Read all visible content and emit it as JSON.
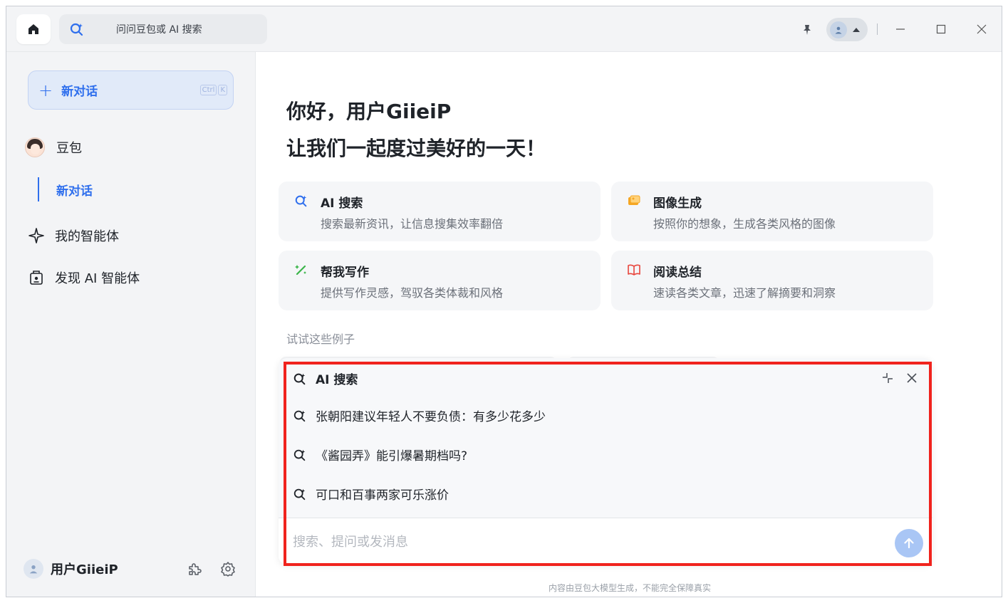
{
  "colors": {
    "accent": "#2f6fed",
    "highlight": "#f0231d",
    "sidebar_bg": "#f3f4f6"
  },
  "titlebar": {
    "search_placeholder": "问问豆包或 AI 搜索",
    "icons": [
      "home-icon",
      "ai-search-icon",
      "pin-icon",
      "user-avatar-icon",
      "caret-up-icon",
      "minimize-icon",
      "maximize-icon",
      "close-icon"
    ]
  },
  "sidebar": {
    "new_chat": {
      "label": "新对话",
      "shortcut": [
        "Ctrl",
        "K"
      ]
    },
    "bot": {
      "name": "豆包",
      "sub_item": "新对话"
    },
    "nav": [
      {
        "label": "我的智能体",
        "icon": "sparkle-icon"
      },
      {
        "label": "发现 AI 智能体",
        "icon": "discover-agent-icon"
      }
    ],
    "user": {
      "name": "用户GiieiP",
      "icons": [
        "plugin-icon",
        "settings-icon"
      ]
    }
  },
  "main": {
    "greeting_line1": "你好，用户GiieiP",
    "greeting_line2": "让我们一起度过美好的一天！",
    "cards": [
      {
        "title": "AI 搜索",
        "desc": "搜索最新资讯，让信息搜集效率翻倍",
        "icon": "ai-search-icon",
        "icon_color": "#2f6fed"
      },
      {
        "title": "图像生成",
        "desc": "按照你的想象，生成各类风格的图像",
        "icon": "image-gen-icon",
        "icon_color": "#f5a623"
      },
      {
        "title": "帮我写作",
        "desc": "提供写作灵感，驾驭各类体裁和风格",
        "icon": "writing-icon",
        "icon_color": "#3bb54a"
      },
      {
        "title": "阅读总结",
        "desc": "速读各类文章，迅速了解摘要和洞察",
        "icon": "book-icon",
        "icon_color": "#e8453c"
      }
    ],
    "examples_label": "试试这些例子",
    "disclaimer": "内容由豆包大模型生成，不能完全保障真实"
  },
  "panel": {
    "title": "AI 搜索",
    "suggestions": [
      "张朝阳建议年轻人不要负债：有多少花多少",
      "《酱园弄》能引爆暑期档吗?",
      "可口和百事两家可乐涨价"
    ],
    "input_placeholder": "搜索、提问或发消息",
    "input_value": ""
  }
}
